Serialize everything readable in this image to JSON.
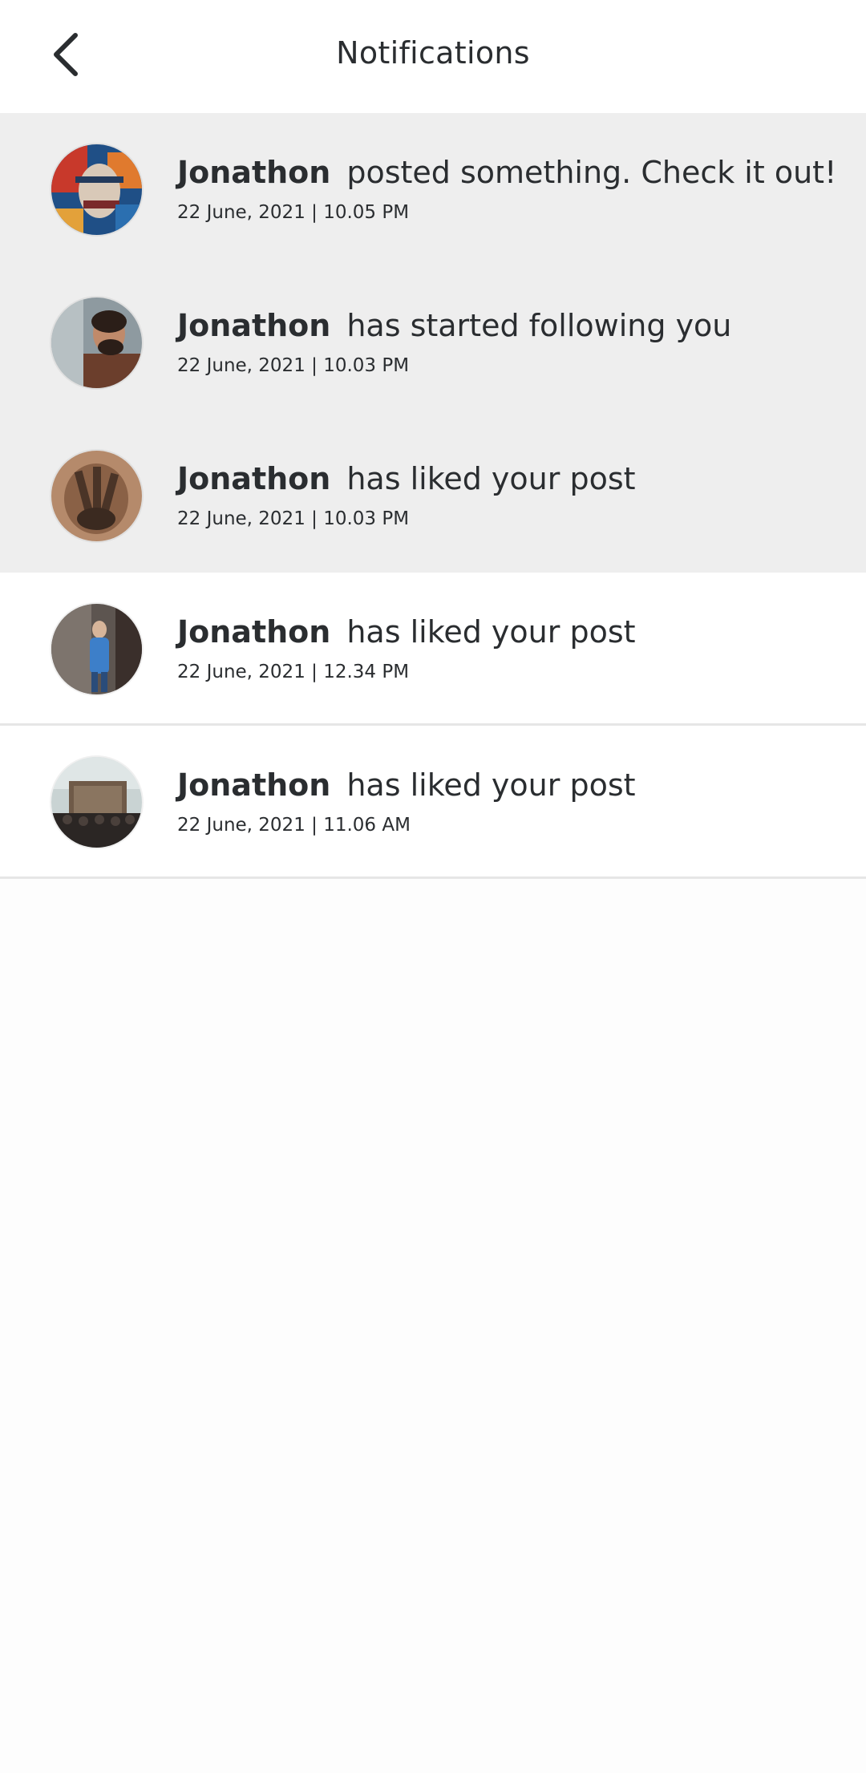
{
  "header": {
    "title": "Notifications",
    "back_icon": "chevron-left-icon"
  },
  "notifications": [
    {
      "name": "Jonathon",
      "message": "posted something. Check it out!",
      "time": "22 June, 2021 | 10.05 PM",
      "unread": true,
      "avatar": "street-art-face"
    },
    {
      "name": "Jonathon",
      "message": "has started following you",
      "time": "22 June, 2021 | 10.03 PM",
      "unread": true,
      "avatar": "bearded-man"
    },
    {
      "name": "Jonathon",
      "message": "has liked your post",
      "time": "22 June, 2021 | 10.03 PM",
      "unread": true,
      "avatar": "clay-hands"
    },
    {
      "name": "Jonathon",
      "message": "has liked your post",
      "time": "22 June, 2021 | 12.34 PM",
      "unread": false,
      "avatar": "person-in-blue"
    },
    {
      "name": "Jonathon",
      "message": "has liked your post",
      "time": "22 June, 2021 | 11.06 AM",
      "unread": false,
      "avatar": "crowd-stage"
    }
  ],
  "colors": {
    "unread_bg": "#eeeeee",
    "read_bg": "#ffffff",
    "text": "#2a2d30",
    "divider": "#e6e6e6"
  }
}
